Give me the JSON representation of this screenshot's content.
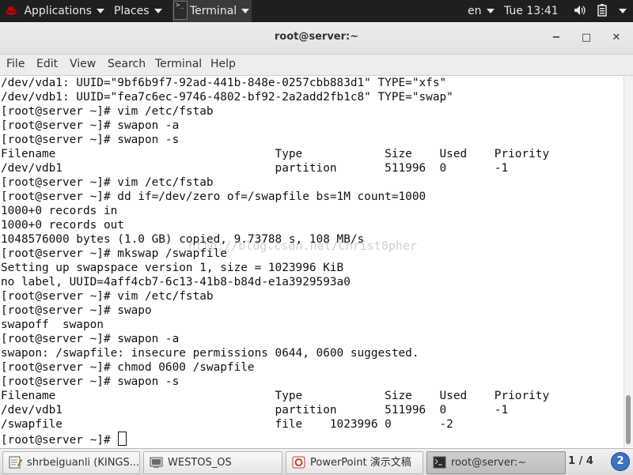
{
  "top_panel": {
    "applications": "Applications",
    "places": "Places",
    "terminal": "Terminal",
    "lang": "en",
    "clock": "Tue 13:41"
  },
  "window": {
    "title": "root@server:~",
    "minimize": "−",
    "maximize": "□",
    "close": "✕"
  },
  "menubar": [
    "File",
    "Edit",
    "View",
    "Search",
    "Terminal",
    "Help"
  ],
  "terminal": {
    "lines": [
      "/dev/vda1: UUID=\"9bf6b9f7-92ad-441b-848e-0257cbb883d1\" TYPE=\"xfs\"",
      "/dev/vdb1: UUID=\"fea7c6ec-9746-4802-bf92-2a2add2fb1c8\" TYPE=\"swap\"",
      "[root@server ~]# vim /etc/fstab",
      "[root@server ~]# swapon -a",
      "[root@server ~]# swapon -s",
      "Filename                                Type            Size    Used    Priority",
      "/dev/vdb1                               partition       511996  0       -1",
      "[root@server ~]# vim /etc/fstab",
      "[root@server ~]# dd if=/dev/zero of=/swapfile bs=1M count=1000",
      "1000+0 records in",
      "1000+0 records out",
      "1048576000 bytes (1.0 GB) copied, 9.73788 s, 108 MB/s",
      "[root@server ~]# mkswap /swapfile",
      "Setting up swapspace version 1, size = 1023996 KiB",
      "no label, UUID=4aff4cb7-6c13-41b8-b84d-e1a3929593a0",
      "[root@server ~]# vim /etc/fstab",
      "[root@server ~]# swapo",
      "swapoff  swapon",
      "[root@server ~]# swapon -a",
      "swapon: /swapfile: insecure permissions 0644, 0600 suggested.",
      "[root@server ~]# chmod 0600 /swapfile",
      "[root@server ~]# swapon -s",
      "Filename                                Type            Size    Used    Priority",
      "/dev/vdb1                               partition       511996  0       -1",
      "/swapfile                               file    1023996 0       -2"
    ],
    "prompt": "[root@server ~]# ",
    "watermark": "http://blog.csdn.net/Christ0pher"
  },
  "taskbar": {
    "tasks": [
      {
        "label": "shrbeiguanli (KINGS..."
      },
      {
        "label": "WESTOS_OS"
      },
      {
        "label": "PowerPoint 演示文稿"
      },
      {
        "label": "root@server:~"
      }
    ],
    "pager": "1 / 4",
    "help": "2"
  },
  "colors": {
    "panel_bg": "#1f1f1f",
    "terminal_bg": "#ffffff",
    "terminal_fg": "#111111",
    "help_blue": "#3b73c3"
  }
}
